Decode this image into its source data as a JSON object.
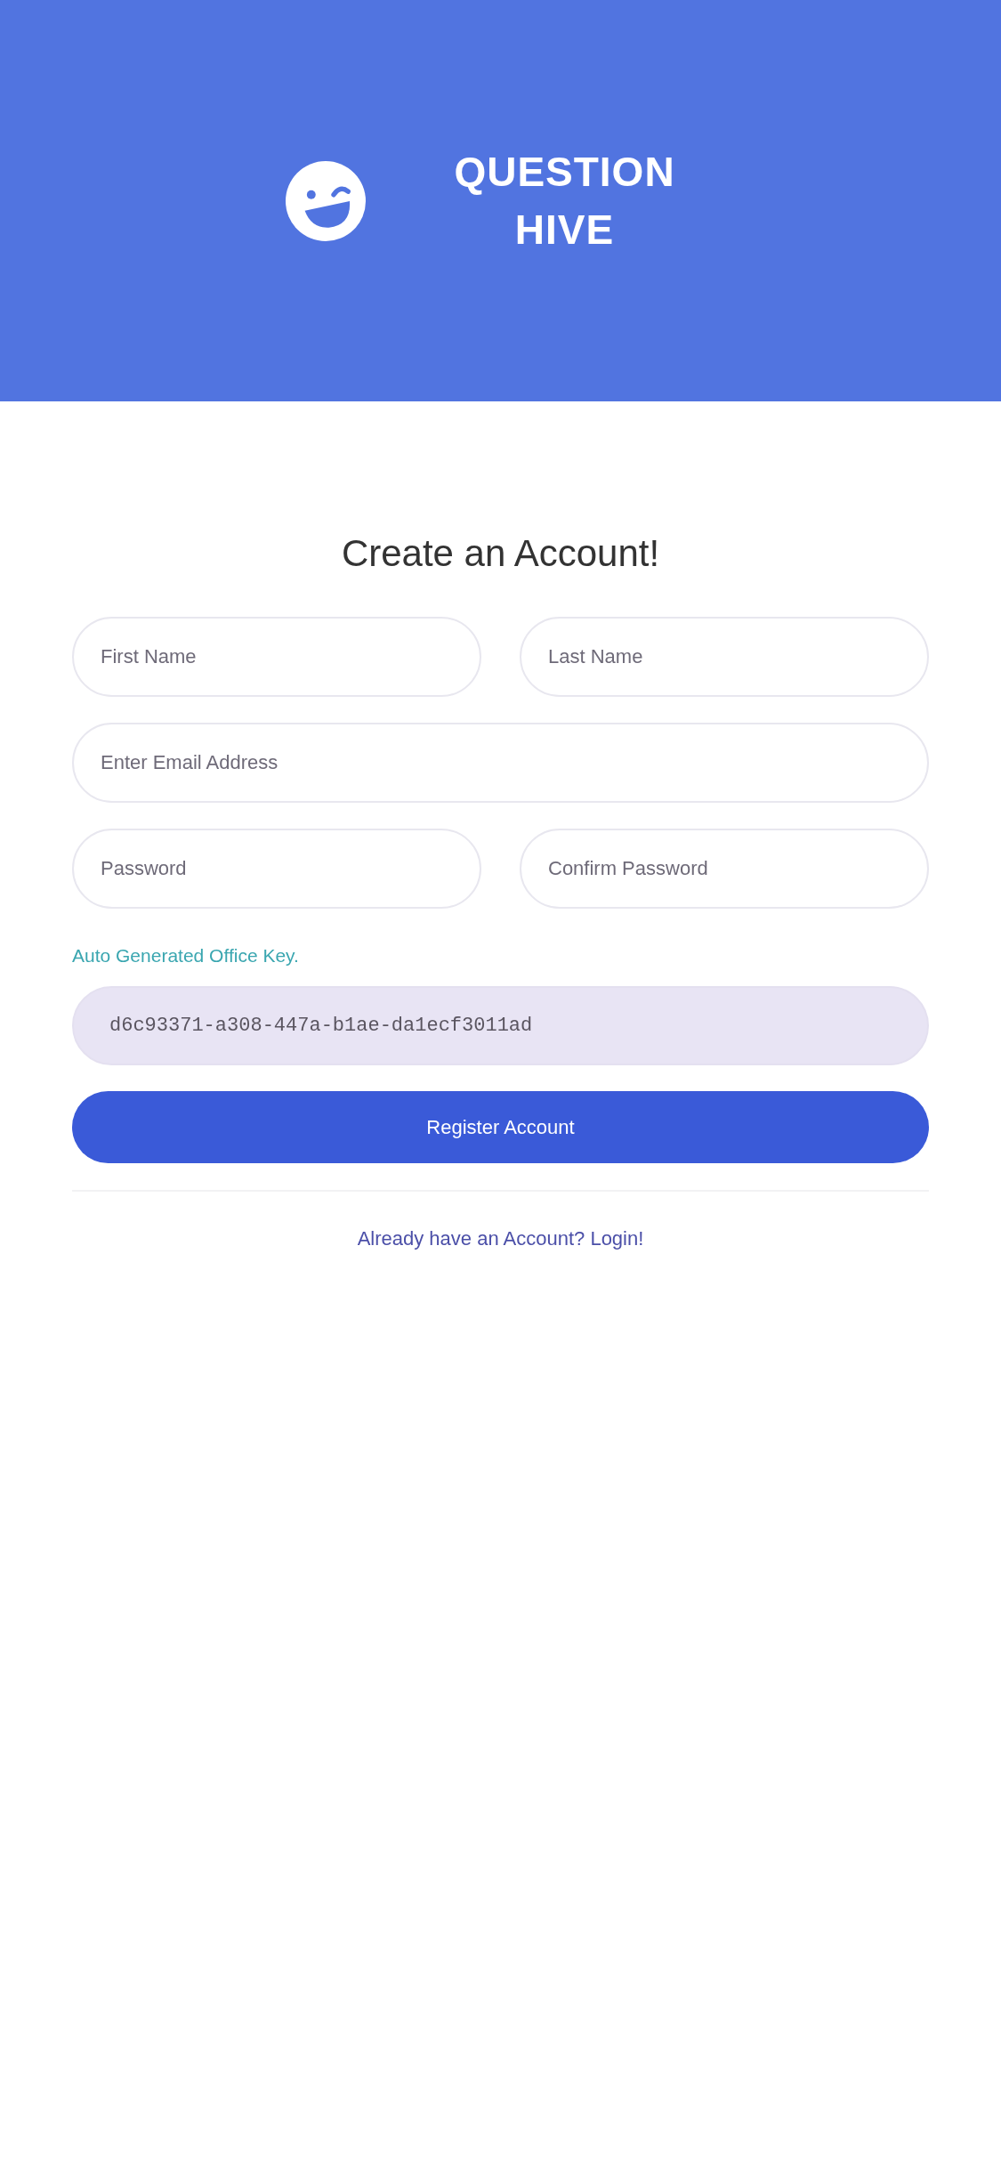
{
  "header": {
    "title": "QUESTION HIVE"
  },
  "form": {
    "heading": "Create an Account!",
    "rows": [
      [
        {
          "placeholder": "First Name"
        },
        {
          "placeholder": "Last Name"
        }
      ],
      [
        {
          "placeholder": "Enter Email Address"
        }
      ],
      [
        {
          "placeholder": "Password"
        },
        {
          "placeholder": "Confirm Password"
        }
      ]
    ],
    "office_key": {
      "label": "Auto Generated Office Key.",
      "value": "d6c93371-a308-447a-b1ae-da1ecf3011ad",
      "readonly": true
    },
    "submit": "Register Account",
    "login_link": "Already have an Account? Login!"
  }
}
